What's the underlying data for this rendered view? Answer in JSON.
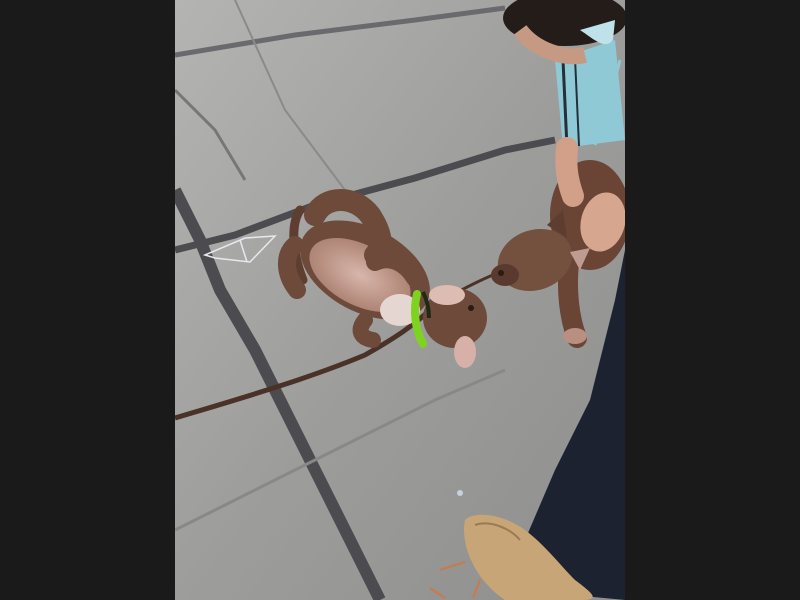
{
  "photo": {
    "subjects": [
      "puppy-lying-on-back",
      "standing-puppy",
      "person-holding-puppy",
      "leash",
      "harness"
    ],
    "colors": {
      "background_bars": "#1a1a1a",
      "floor": "#9a9a98",
      "floor_lines": "#4a4a4e",
      "puppy_fur": "#6e4a3a",
      "puppy_belly": "#c9a59a",
      "harness": "#7ed321",
      "leash": "#4a3228",
      "sleeve": "#8fc9d6",
      "pants": "#1c2230",
      "shoe": "#c8a577"
    }
  }
}
